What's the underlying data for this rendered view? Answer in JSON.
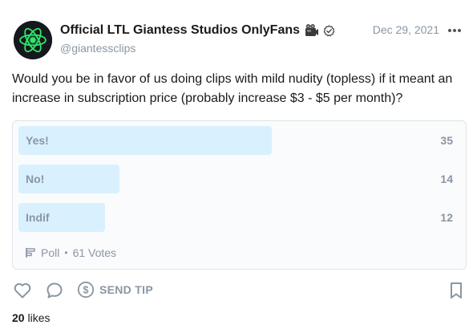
{
  "post": {
    "author": {
      "display_name": "Official LTL Giantess Studios OnlyFans",
      "handle": "@giantessclips",
      "avatar_icon": "atom-icon",
      "emoji_icon": "film-camera-icon",
      "verified_icon": "verified-icon"
    },
    "date": "Dec 29, 2021",
    "text": "Would you be in favor of us doing clips with mild nudity (topless) if it meant an increase in subscription price (probably increase $3 - $5 per month)?",
    "poll": {
      "options": [
        {
          "label": "Yes!",
          "count": "35",
          "share": 0.5738
        },
        {
          "label": "No!",
          "count": "14",
          "share": 0.2295
        },
        {
          "label": "Indif",
          "count": "12",
          "share": 0.1967
        }
      ],
      "type_label": "Poll",
      "separator": "•",
      "votes_label": "61 Votes"
    },
    "actions": {
      "send_tip_label": "SEND TIP"
    },
    "likes": {
      "count": "20",
      "label": "likes"
    }
  },
  "colors": {
    "bar_fill": "#d9f0ff",
    "muted_text": "#8a96a3",
    "avatar_glow": "#2ee86a"
  }
}
